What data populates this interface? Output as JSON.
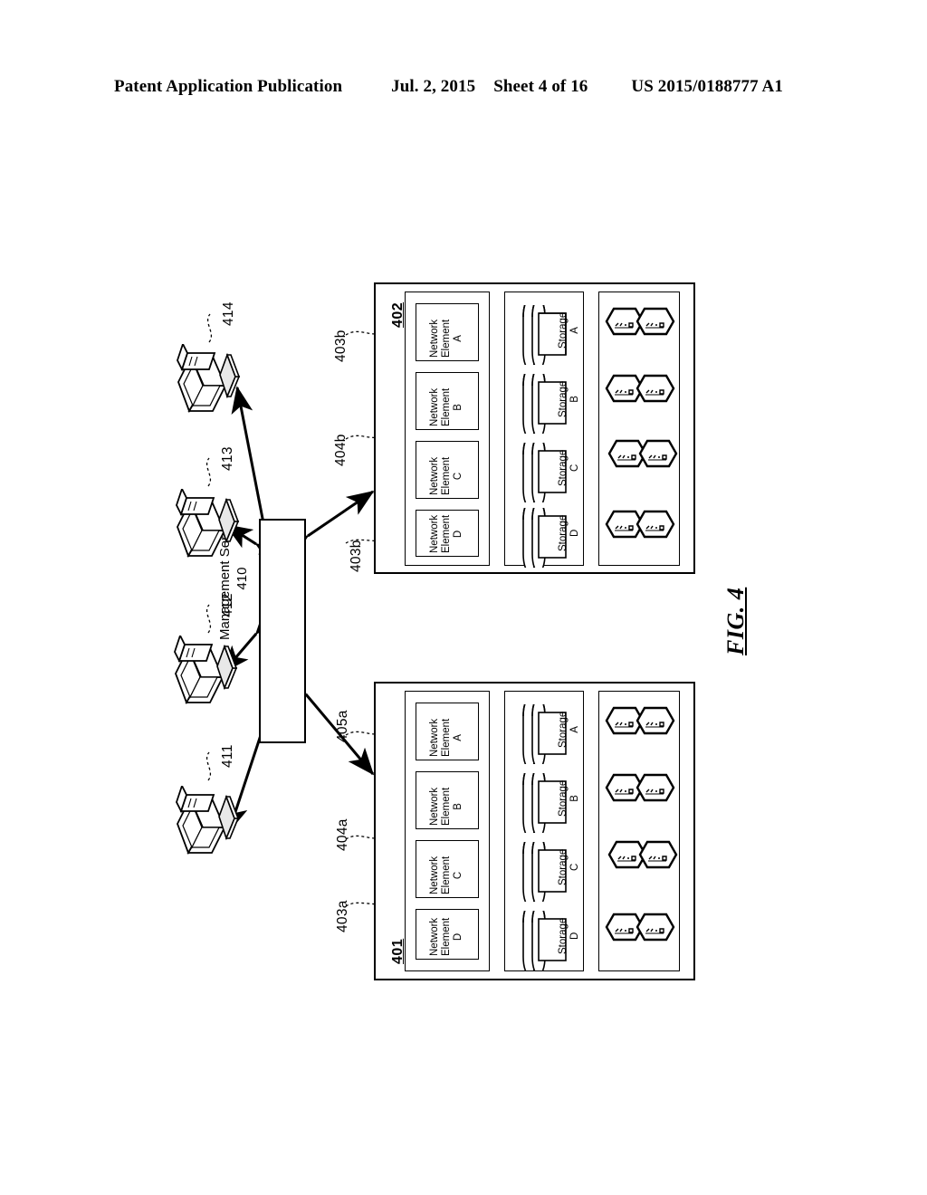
{
  "header": {
    "publication": "Patent Application Publication",
    "date": "Jul. 2, 2015",
    "sheet": "Sheet 4 of 16",
    "number": "US 2015/0188777 A1"
  },
  "figure": {
    "caption": "FIG. 4"
  },
  "management_server": {
    "title": "Management Server",
    "ref": "410"
  },
  "clients": [
    {
      "ref": "411",
      "icon": "workstation-icon"
    },
    {
      "ref": "412",
      "icon": "workstation-icon"
    },
    {
      "ref": "413",
      "icon": "workstation-icon"
    },
    {
      "ref": "414",
      "icon": "workstation-icon"
    }
  ],
  "systems": [
    {
      "id": "system-402",
      "ref": "402",
      "groups": {
        "network_elements": {
          "ref": "403b",
          "items": [
            {
              "line1": "Network",
              "line2": "Element",
              "line3": "A"
            },
            {
              "line1": "Network",
              "line2": "Element",
              "line3": "B"
            },
            {
              "line1": "Network",
              "line2": "Element",
              "line3": "C"
            },
            {
              "line1": "Network",
              "line2": "Element",
              "line3": "D"
            }
          ]
        },
        "storage": {
          "ref": "404b",
          "items": [
            {
              "line1": "Storage",
              "line2": "A"
            },
            {
              "line1": "Storage",
              "line2": "B"
            },
            {
              "line1": "Storage",
              "line2": "C"
            },
            {
              "line1": "Storage",
              "line2": "D"
            }
          ]
        },
        "nodes": {
          "ref": "403b",
          "count": 8,
          "icon": "hexagon-node-icon"
        }
      }
    },
    {
      "id": "system-401",
      "ref": "401",
      "groups": {
        "network_elements": {
          "ref": "405a",
          "items": [
            {
              "line1": "Network",
              "line2": "Element",
              "line3": "A"
            },
            {
              "line1": "Network",
              "line2": "Element",
              "line3": "B"
            },
            {
              "line1": "Network",
              "line2": "Element",
              "line3": "C"
            },
            {
              "line1": "Network",
              "line2": "Element",
              "line3": "D"
            }
          ]
        },
        "storage": {
          "ref": "404a",
          "items": [
            {
              "line1": "Storage",
              "line2": "A"
            },
            {
              "line1": "Storage",
              "line2": "B"
            },
            {
              "line1": "Storage",
              "line2": "C"
            },
            {
              "line1": "Storage",
              "line2": "D"
            }
          ]
        },
        "nodes": {
          "ref": "403a",
          "count": 8,
          "icon": "hexagon-node-icon"
        }
      }
    }
  ],
  "colors": {
    "line": "#000000",
    "background": "#ffffff"
  }
}
